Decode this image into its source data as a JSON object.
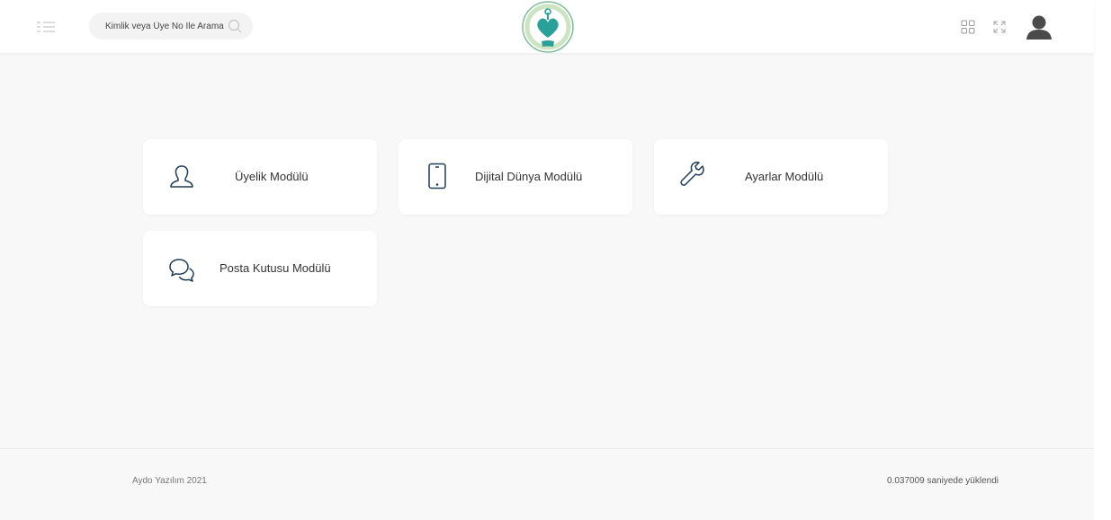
{
  "header": {
    "search": {
      "placeholder": "Kimlik veya Üye No İle Arama",
      "value": ""
    },
    "icons": {
      "menu": "menu-toggle-icon",
      "search": "search-icon",
      "logo": "organization-logo",
      "apps": "apps-grid-icon",
      "fullscreen": "fullscreen-icon",
      "user": "user-avatar-icon"
    }
  },
  "modules": [
    {
      "label": "Üyelik Modülü",
      "icon": "user-icon"
    },
    {
      "label": "Dijital Dünya Modülü",
      "icon": "tablet-icon"
    },
    {
      "label": "Ayarlar Modülü",
      "icon": "wrench-icon"
    },
    {
      "label": "Posta Kutusu Modülü",
      "icon": "chat-icon"
    }
  ],
  "footer": {
    "copyright": "Aydo Yazılım 2021",
    "load_time": "0.037009 saniyede yüklendi"
  },
  "colors": {
    "accent": "#1a9a9a",
    "logo_heart": "#2aa198",
    "icon_stroke": "#1d3b5a",
    "background": "#f8f8f8"
  }
}
